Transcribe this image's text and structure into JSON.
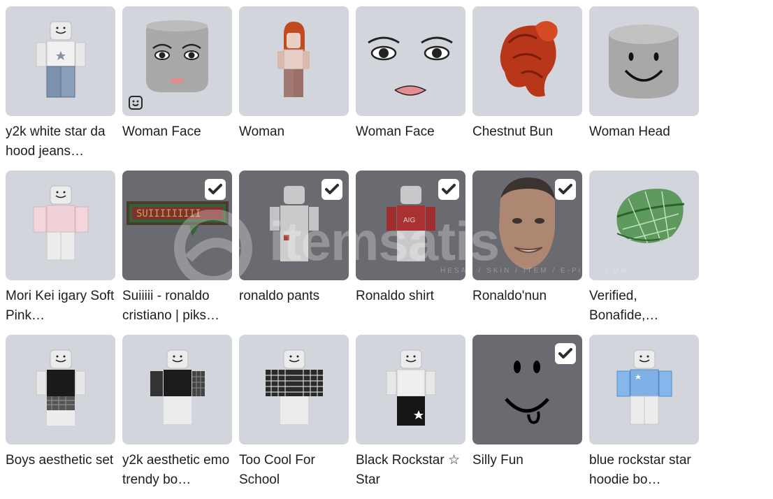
{
  "watermark": {
    "text": "itemsatis",
    "subtext": "HESAP / SKIN / ITEM / E-PIN / .COM"
  },
  "items": [
    {
      "name": "y2k white star da hood jeans…",
      "equipped": false,
      "icon": "shirt-jeans-avatar"
    },
    {
      "name": "Woman Face",
      "equipped": false,
      "icon": "face-on-head",
      "badge": "emote-face-icon"
    },
    {
      "name": "Woman",
      "equipped": false,
      "icon": "woman-avatar"
    },
    {
      "name": "Woman Face",
      "equipped": false,
      "icon": "face-decal"
    },
    {
      "name": "Chestnut Bun",
      "equipped": false,
      "icon": "hair"
    },
    {
      "name": "Woman Head",
      "equipped": false,
      "icon": "head"
    },
    {
      "name": "Mori Kei igary Soft Pink…",
      "equipped": false,
      "icon": "pink-shirt-avatar"
    },
    {
      "name": "Suiiiii - ronaldo cristiano | piks…",
      "equipped": true,
      "icon": "pixel-sign"
    },
    {
      "name": "ronaldo pants",
      "equipped": true,
      "icon": "pants-avatar"
    },
    {
      "name": "Ronaldo shirt",
      "equipped": true,
      "icon": "red-shirt-avatar"
    },
    {
      "name": "Ronaldo'nun",
      "equipped": true,
      "icon": "face-photo"
    },
    {
      "name": "Verified, Bonafide,…",
      "equipped": false,
      "icon": "green-plaid-cap"
    },
    {
      "name": "Boys aesthetic set",
      "equipped": false,
      "icon": "black-shirt-avatar"
    },
    {
      "name": "y2k aesthetic emo trendy bo…",
      "equipped": false,
      "icon": "emo-shirt-avatar"
    },
    {
      "name": "Too Cool For School",
      "equipped": false,
      "icon": "plaid-shirt-avatar"
    },
    {
      "name": "Black Rockstar ☆ Star",
      "equipped": false,
      "icon": "rockstar-pants-avatar"
    },
    {
      "name": "Silly Fun",
      "equipped": true,
      "icon": "silly-face"
    },
    {
      "name": "blue rockstar star hoodie bo…",
      "equipped": false,
      "icon": "blue-hoodie-avatar"
    }
  ]
}
